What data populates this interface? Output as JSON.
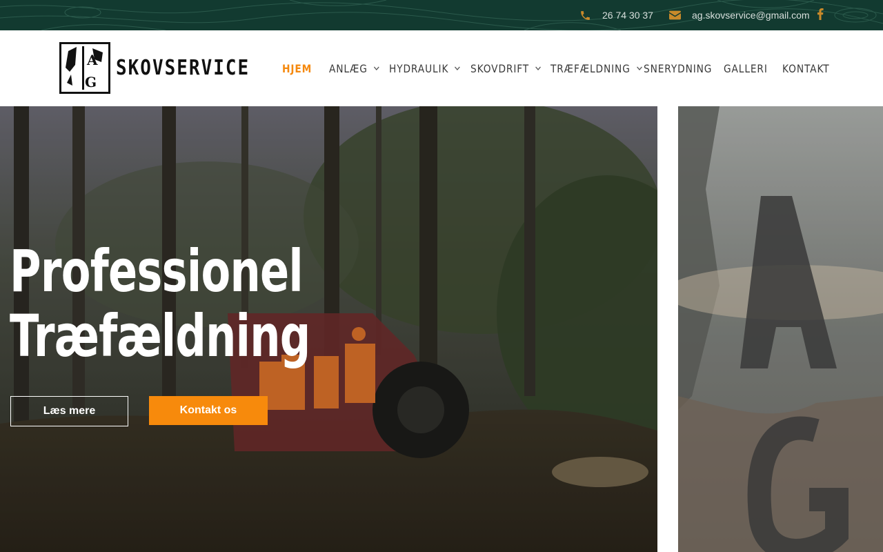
{
  "topbar": {
    "phone": "26 74 30 37",
    "email": "ag.skovservice@gmail.com",
    "icons": {
      "phone": "phone-icon",
      "email": "envelope-icon",
      "social": "facebook-icon"
    },
    "accent": "#c98a2a"
  },
  "header": {
    "logo": {
      "mark": "A G",
      "text": "SKOVSERVICE"
    },
    "nav": [
      {
        "label": "HJEM",
        "active": true,
        "dropdown": false
      },
      {
        "label": "ANLÆG",
        "active": false,
        "dropdown": true
      },
      {
        "label": "HYDRAULIK",
        "active": false,
        "dropdown": true
      },
      {
        "label": "SKOVDRIFT",
        "active": false,
        "dropdown": true
      },
      {
        "label": "TRÆFÆLDNING",
        "active": false,
        "dropdown": true
      },
      {
        "label": "SNERYDNING",
        "active": false,
        "dropdown": false
      },
      {
        "label": "GALLERI",
        "active": false,
        "dropdown": false
      },
      {
        "label": "KONTAKT",
        "active": false,
        "dropdown": false
      }
    ]
  },
  "hero": {
    "title_line1": "Professionel",
    "title_line2": "Træfældning",
    "primary_button": "Læs mere",
    "secondary_button": "Kontakt os"
  },
  "colors": {
    "topbar_bg": "#123a30",
    "accent_orange": "#f78a0c",
    "nav_text": "#3a3a3a"
  }
}
